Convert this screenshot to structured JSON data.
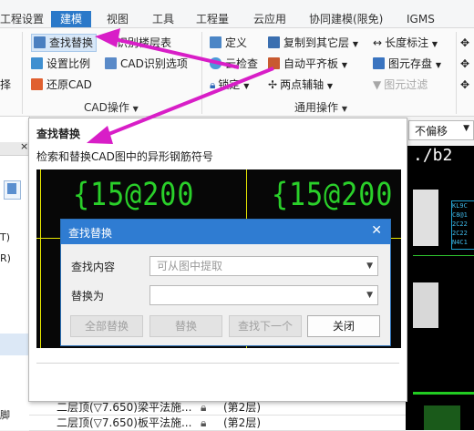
{
  "menubar": {
    "tabs": [
      {
        "label": "工程设置"
      },
      {
        "label": "建模"
      },
      {
        "label": "视图"
      },
      {
        "label": "工具"
      },
      {
        "label": "工程量"
      },
      {
        "label": "云应用"
      },
      {
        "label": "协同建模(限免)"
      },
      {
        "label": "IGMS"
      }
    ]
  },
  "ribbon": {
    "partial_left": "择",
    "cad_group": {
      "find_replace": "查找替换",
      "recognize_floor": "识别楼层表",
      "set_scale": "设置比例",
      "cad_options": "CAD识别选项",
      "restore_cad": "还原CAD",
      "group_label": "CAD操作"
    },
    "common_group": {
      "define": "定义",
      "copy_to_other": "复制到其它层",
      "length_dim": "长度标注",
      "cloud_check": "云检查",
      "auto_level_slab": "自动平齐板",
      "drawing_save": "图元存盘",
      "lock": "锁定",
      "two_point_axis": "两点辅轴",
      "drawing_filter": "图元过滤",
      "group_label": "通用操作"
    },
    "colors": {
      "accent": "#2b79c9",
      "arrow": "#d81ec7"
    }
  },
  "leftpanel": {
    "partial_1": "T)",
    "partial_2": "R)",
    "partial_3": "脚"
  },
  "tooltip": {
    "title": "查找替换",
    "description": "检索和替换CAD图中的异形钢筋符号",
    "cad_text_left": "{15@200",
    "cad_text_right": "{15@200"
  },
  "dialog": {
    "title": "查找替换",
    "find_label": "查找内容",
    "find_placeholder": "可从图中提取",
    "replace_label": "替换为",
    "replace_value": "",
    "buttons": {
      "replace_all": "全部替换",
      "replace": "替换",
      "find_next": "查找下一个",
      "close": "关闭"
    }
  },
  "topright": {
    "offset_select": "不偏移"
  },
  "cad_right": {
    "label_top": "./b2",
    "annot": "KL9C\nC8@1\n2C22\n2C22\nN4C1"
  },
  "table": {
    "rows": [
      {
        "name": "二层顶(▽7.650)梁平法施...",
        "layer": "(第2层)"
      },
      {
        "name": "二层顶(▽7.650)板平法施...",
        "layer": "(第2层)"
      }
    ]
  }
}
